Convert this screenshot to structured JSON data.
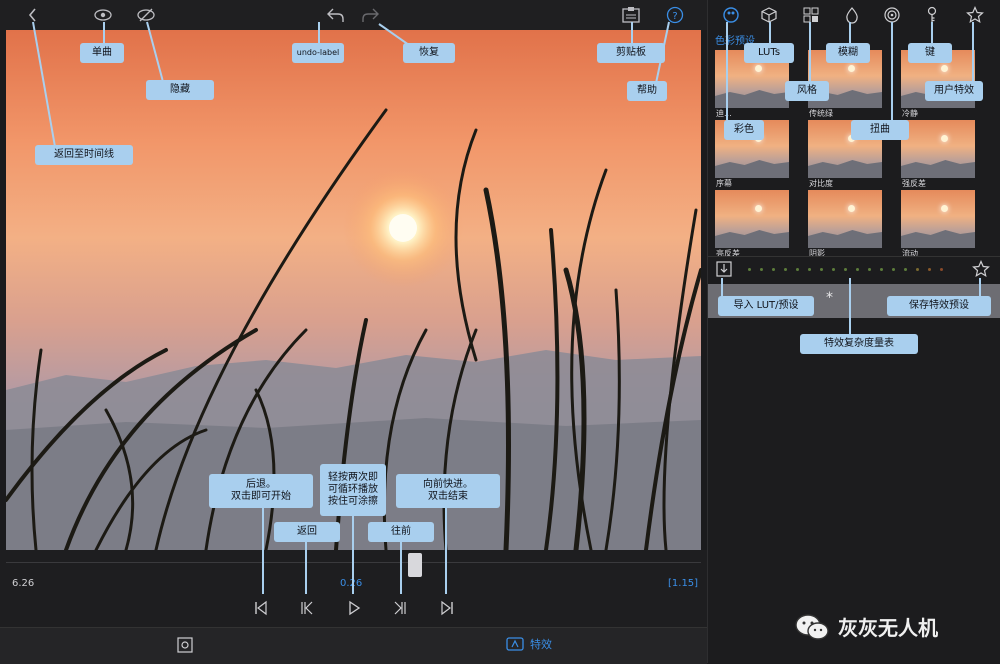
{
  "colors": {
    "accent": "#3a8ee6",
    "callout": "#a9cfee",
    "panel": "#1c1c1e"
  },
  "timeline": {
    "start": "6.26",
    "current": "0.26",
    "end": "[1.15]"
  },
  "bottombar": {
    "effects_label": "特效"
  },
  "panel": {
    "section_title": "色彩预设",
    "presets": [
      "迪...",
      "传统绿",
      "冷静",
      "序幕",
      "对比度",
      "强反差",
      "亮反差",
      "阴影",
      "流动"
    ]
  },
  "callouts": {
    "back_timeline": "返回至时间线",
    "single": "单曲",
    "hide": "隐藏",
    "undo": "undo-label",
    "redo": "恢复",
    "clipboard": "剪贴板",
    "help": "帮助",
    "luts": "LUTs",
    "style": "风格",
    "blur": "模糊",
    "key": "键",
    "user_effects": "用户特效",
    "color": "彩色",
    "distort": "扭曲",
    "import_lut": "导入 LUT/预设",
    "save_preset": "保存特效预设",
    "complexity": "特效复杂度量表",
    "rewind": "后退。\n双击即可开始",
    "loop": "轻按两次即\n可循环播放\n按住可涂擦",
    "forward": "向前快进。\n双击结束",
    "back": "返回",
    "next": "往前"
  },
  "watermark": "灰灰无人机"
}
